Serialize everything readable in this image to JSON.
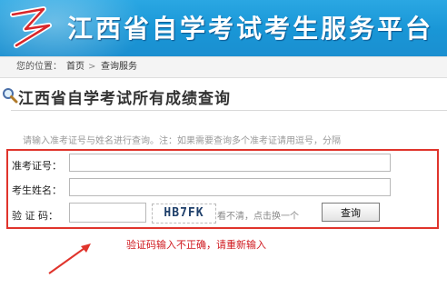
{
  "header": {
    "site_title": "江西省自学考试考生服务平台",
    "accent_color": "#1996d6",
    "logo_icon": "zigzag-logo-icon"
  },
  "breadcrumb": {
    "label": "您的位置：",
    "home": "首页",
    "separator": ">",
    "current": "查询服务"
  },
  "section": {
    "title": "江西省自学考试所有成绩查询",
    "icon": "magnifier-icon"
  },
  "form": {
    "instruction": "请输入准考证号与姓名进行查询。注：如果需要查询多个准考证请用逗号，分隔",
    "ticket_label": "准考证号：",
    "ticket_value": "",
    "name_label": "考生姓名：",
    "name_value": "",
    "captcha_label": "验 证 码：",
    "captcha_value": "",
    "captcha_text": "HB7FK",
    "refresh_link": "看不清，点击换一个",
    "submit_label": "查询"
  },
  "error": {
    "message": "验证码输入不正确，请重新输入",
    "color": "#d0191f"
  }
}
